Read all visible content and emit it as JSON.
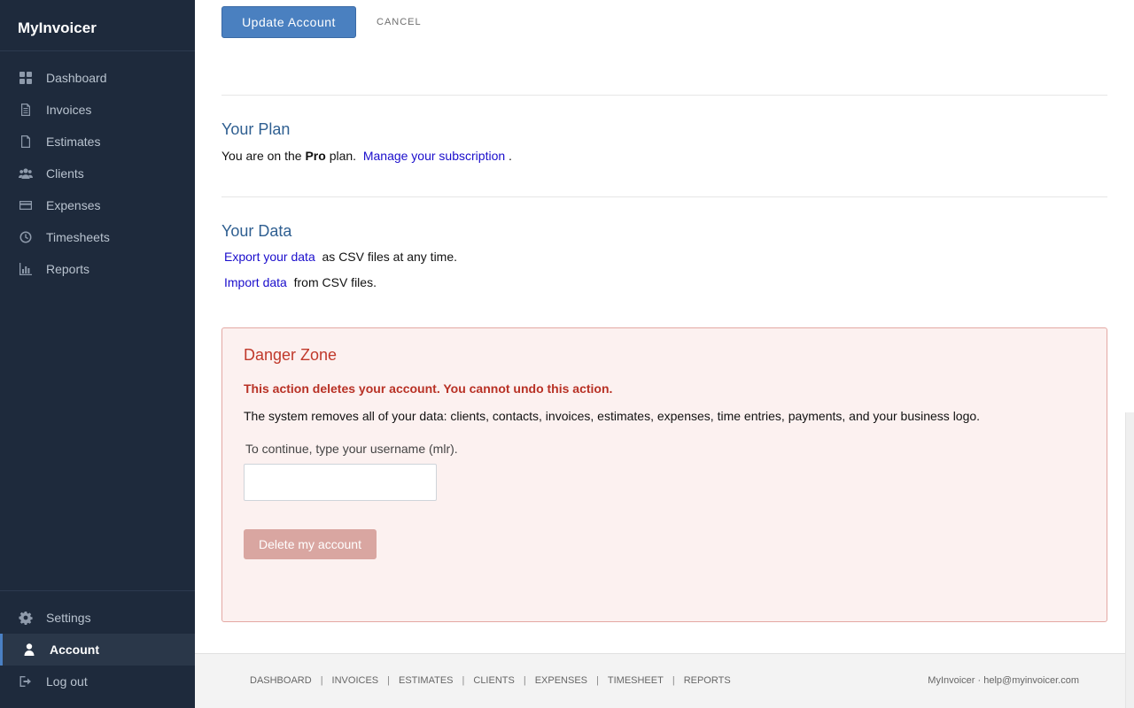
{
  "app": {
    "brand": "MyInvoicer"
  },
  "sidebar": {
    "items": [
      {
        "label": "Dashboard",
        "icon": "dashboard-icon"
      },
      {
        "label": "Invoices",
        "icon": "invoice-icon"
      },
      {
        "label": "Estimates",
        "icon": "estimate-icon"
      },
      {
        "label": "Clients",
        "icon": "clients-icon"
      },
      {
        "label": "Expenses",
        "icon": "credit-card-icon"
      },
      {
        "label": "Timesheets",
        "icon": "clock-icon"
      },
      {
        "label": "Reports",
        "icon": "bar-chart-icon"
      }
    ],
    "bottom_items": [
      {
        "label": "Settings",
        "icon": "gear-icon"
      },
      {
        "label": "Account",
        "icon": "user-icon",
        "active": true
      },
      {
        "label": "Log out",
        "icon": "logout-icon"
      }
    ]
  },
  "actions": {
    "update_label": "Update Account",
    "cancel_label": "CANCEL"
  },
  "plan": {
    "title": "Your Plan",
    "prefix": "You are on the",
    "plan_name": "Pro",
    "suffix": "plan.",
    "link": "Manage your subscription",
    "end": "."
  },
  "data_section": {
    "title": "Your Data",
    "export_link": "Export your data",
    "export_text": "as CSV files at any time.",
    "import_link": "Import data",
    "import_text": "from CSV files."
  },
  "danger": {
    "title": "Danger Zone",
    "warning": "This action deletes your account. You cannot undo this action.",
    "description": "The system removes all of your data: clients, contacts, invoices, estimates, expenses, time entries, payments, and your business logo.",
    "label": "To continue, type your username (mlr).",
    "input_value": "",
    "delete_label": "Delete my account"
  },
  "footer": {
    "links": [
      "DASHBOARD",
      "INVOICES",
      "ESTIMATES",
      "CLIENTS",
      "EXPENSES",
      "TIMESHEET",
      "REPORTS"
    ],
    "right": "MyInvoicer · help@myinvoicer.com"
  },
  "colors": {
    "sidebar_bg": "#1e2a3c",
    "accent": "#4a80c0",
    "danger": "#c0392b"
  }
}
